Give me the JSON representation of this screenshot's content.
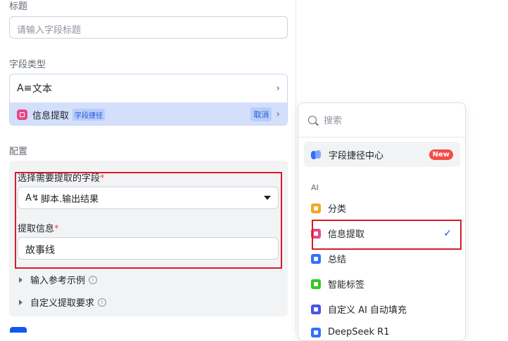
{
  "form": {
    "title_label": "标题",
    "title_placeholder": "请输入字段标题",
    "type_label": "字段类型",
    "type_row_text": "文本",
    "type_row_icon": "text-type-icon",
    "type_selected": "信息提取",
    "type_badge": "字段捷径",
    "type_cancel": "取消",
    "config_label": "配置",
    "select_field_label": "选择需要提取的字段",
    "select_field_value": "脚本.输出结果",
    "extract_info_label": "提取信息",
    "extract_info_value": "故事线",
    "required_mark": "*",
    "collapse_1": "输入参考示例",
    "collapse_2": "自定义提取要求"
  },
  "dropdown": {
    "search_placeholder": "搜索",
    "shortcut_center": "字段捷径中心",
    "new_badge": "New",
    "group_ai": "AI",
    "items": [
      {
        "label": "分类",
        "color": "#f5a623"
      },
      {
        "label": "信息提取",
        "color": "#e6468a",
        "selected": true
      },
      {
        "label": "总结",
        "color": "#3370ff"
      },
      {
        "label": "智能标签",
        "color": "#34c724"
      },
      {
        "label": "自定义 AI 自动填充",
        "color": "#4954e6"
      },
      {
        "label": "DeepSeek R1",
        "color": "#3370ff"
      }
    ]
  },
  "colors": {
    "accent": "#1456f0",
    "selected_bg": "#d4e0fb",
    "highlight_red": "#d71b26",
    "required": "#f54a45"
  }
}
